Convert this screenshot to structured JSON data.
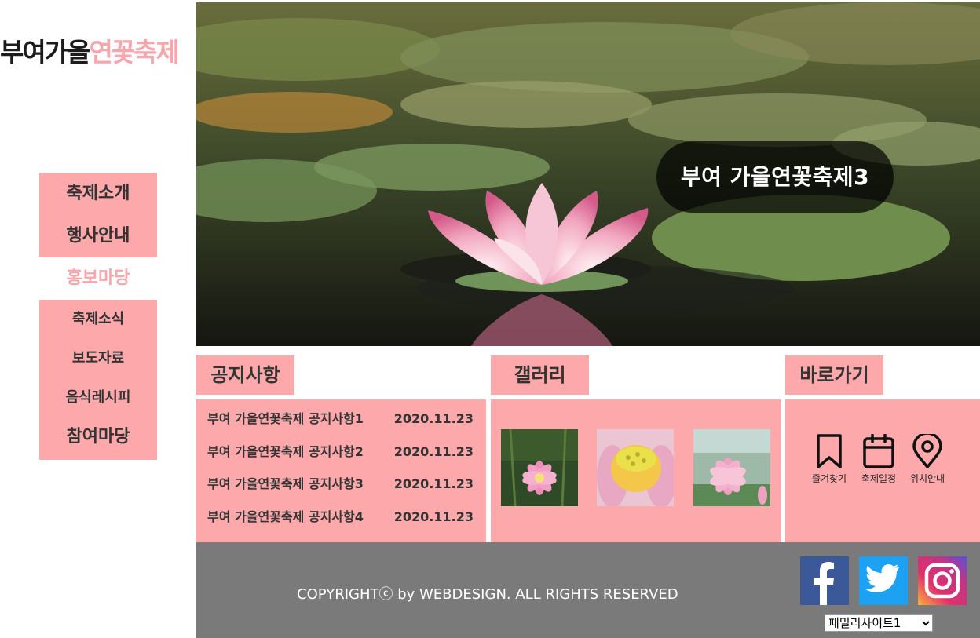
{
  "logo": {
    "part1": "부여가을",
    "part2": "연꽃축제"
  },
  "nav": {
    "top": [
      "축제소개",
      "행사안내"
    ],
    "active": "홍보마당",
    "sub": [
      "축제소식",
      "보도자료",
      "음식레시피"
    ],
    "last": "참여마당"
  },
  "hero": {
    "title": "부여 가을연꽃축제3"
  },
  "sections": {
    "notice": "공지사항",
    "gallery": "갤러리",
    "shortcut": "바로가기"
  },
  "notices": [
    {
      "title": "부여 가을연꽃축제 공지사항1",
      "date": "2020.11.23"
    },
    {
      "title": "부여 가을연꽃축제 공지사항2",
      "date": "2020.11.23"
    },
    {
      "title": "부여 가을연꽃축제 공지사항3",
      "date": "2020.11.23"
    },
    {
      "title": "부여 가을연꽃축제 공지사항4",
      "date": "2020.11.23"
    }
  ],
  "gallery": [
    {
      "icon": "pink-lotus-photo"
    },
    {
      "icon": "lotus-seedpod-photo"
    },
    {
      "icon": "lotus-field-photo"
    }
  ],
  "quick_links": [
    {
      "label": "즐겨찾기",
      "icon": "bookmark-icon"
    },
    {
      "label": "축제일정",
      "icon": "calendar-icon"
    },
    {
      "label": "위치안내",
      "icon": "map-pin-icon"
    }
  ],
  "footer": {
    "copyright": "COPYRIGHTⓒ by WEBDESIGN. ALL RIGHTS RESERVED",
    "family_select": "패밀리사이트1",
    "sns": [
      {
        "icon": "facebook-icon",
        "color": "#3b5998"
      },
      {
        "icon": "twitter-icon",
        "color": "#1da1f2"
      },
      {
        "icon": "instagram-icon",
        "color": "#c13584"
      }
    ]
  },
  "colors": {
    "accent": "#fda9ab",
    "logo_pink": "#f6a6ac",
    "footer_bg": "#7a7a7a"
  }
}
